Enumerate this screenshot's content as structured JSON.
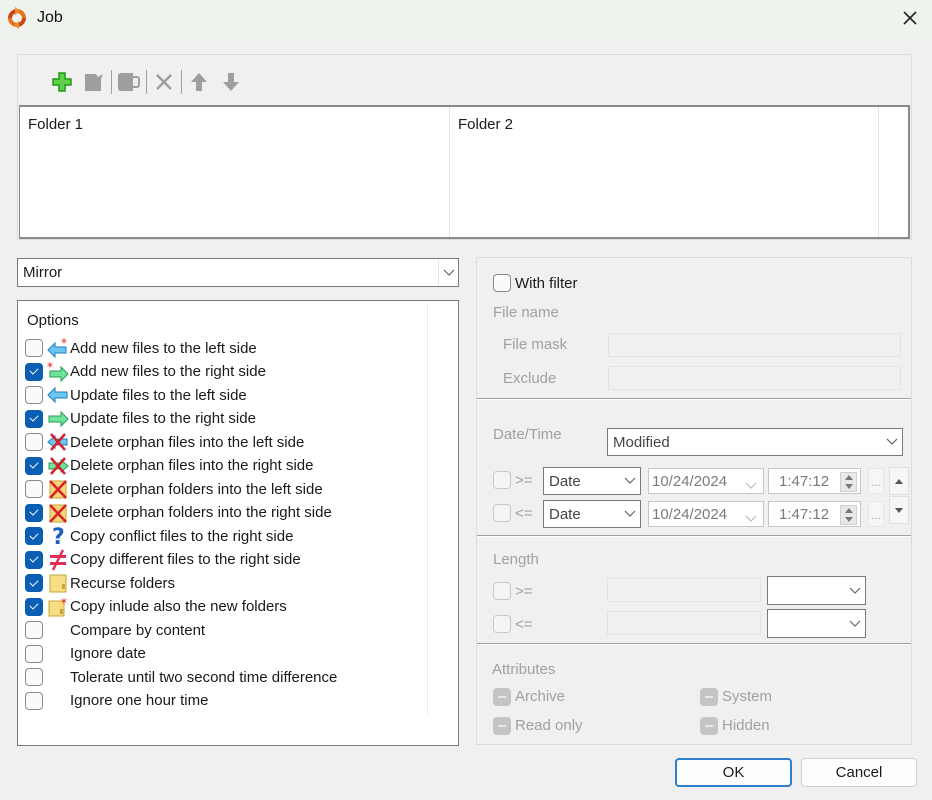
{
  "window": {
    "title": "Job",
    "app_icon": "sync-arrows-icon",
    "close_icon": "close-icon"
  },
  "toolbar": {
    "buttons": [
      {
        "name": "add",
        "icon": "plus-icon",
        "enabled": true
      },
      {
        "name": "edit",
        "icon": "edit-document-icon",
        "enabled": false
      },
      {
        "name": "copy",
        "icon": "duplicate-icon",
        "enabled": false
      },
      {
        "name": "delete",
        "icon": "delete-x-icon",
        "enabled": false
      },
      {
        "name": "move-up",
        "icon": "arrow-up-icon",
        "enabled": false
      },
      {
        "name": "move-down",
        "icon": "arrow-down-icon",
        "enabled": false
      }
    ]
  },
  "folders": {
    "columns": [
      "Folder 1",
      "Folder 2"
    ],
    "rows": []
  },
  "mode": {
    "selected": "Mirror"
  },
  "options": {
    "title": "Options",
    "items": [
      {
        "label": "Add new files to the left side",
        "checked": false,
        "icon": "add-left-arrow-icon"
      },
      {
        "label": "Add new files to the right side",
        "checked": true,
        "icon": "add-right-arrow-icon"
      },
      {
        "label": "Update files to the left side",
        "checked": false,
        "icon": "left-arrow-icon"
      },
      {
        "label": "Update files to the right side",
        "checked": true,
        "icon": "right-arrow-icon"
      },
      {
        "label": "Delete orphan files into the left side",
        "checked": false,
        "icon": "delete-left-icon"
      },
      {
        "label": "Delete orphan files into the right side",
        "checked": true,
        "icon": "delete-right-icon"
      },
      {
        "label": "Delete orphan folders into the left side",
        "checked": false,
        "icon": "delete-folder-icon"
      },
      {
        "label": "Delete orphan folders into the right side",
        "checked": true,
        "icon": "delete-folder-icon"
      },
      {
        "label": "Copy conflict files to the right side",
        "checked": true,
        "icon": "question-icon"
      },
      {
        "label": "Copy different files to the right side",
        "checked": true,
        "icon": "not-equal-icon"
      },
      {
        "label": "Recurse folders",
        "checked": true,
        "icon": "folder-icon"
      },
      {
        "label": "Copy inlude also the new folders",
        "checked": true,
        "icon": "new-folder-icon"
      },
      {
        "label": "Compare by content",
        "checked": false,
        "icon": null
      },
      {
        "label": "Ignore date",
        "checked": false,
        "icon": null
      },
      {
        "label": "Tolerate until two second time difference",
        "checked": false,
        "icon": null
      },
      {
        "label": "Ignore one hour time",
        "checked": false,
        "icon": null
      }
    ]
  },
  "filter": {
    "with_filter_label": "With filter",
    "with_filter_checked": false,
    "file_name_label": "File name",
    "file_mask_label": "File mask",
    "file_mask_value": "",
    "exclude_label": "Exclude",
    "exclude_value": "",
    "datetime_label": "Date/Time",
    "datetime_mode": "Modified",
    "date_rows": [
      {
        "operator": ">=",
        "checked": false,
        "type": "Date",
        "date": "10/24/2024",
        "time": "1:47:12",
        "more": "..."
      },
      {
        "operator": "<=",
        "checked": false,
        "type": "Date",
        "date": "10/24/2024",
        "time": "1:47:12",
        "more": "..."
      }
    ],
    "length_label": "Length",
    "length_rows": [
      {
        "operator": ">=",
        "checked": false,
        "value": "",
        "unit": ""
      },
      {
        "operator": "<=",
        "checked": false,
        "value": "",
        "unit": ""
      }
    ],
    "attributes_label": "Attributes",
    "attributes": [
      {
        "label": "Archive",
        "state": "indeterminate"
      },
      {
        "label": "System",
        "state": "indeterminate"
      },
      {
        "label": "Read only",
        "state": "indeterminate"
      },
      {
        "label": "Hidden",
        "state": "indeterminate"
      }
    ]
  },
  "footer": {
    "ok_label": "OK",
    "cancel_label": "Cancel"
  }
}
